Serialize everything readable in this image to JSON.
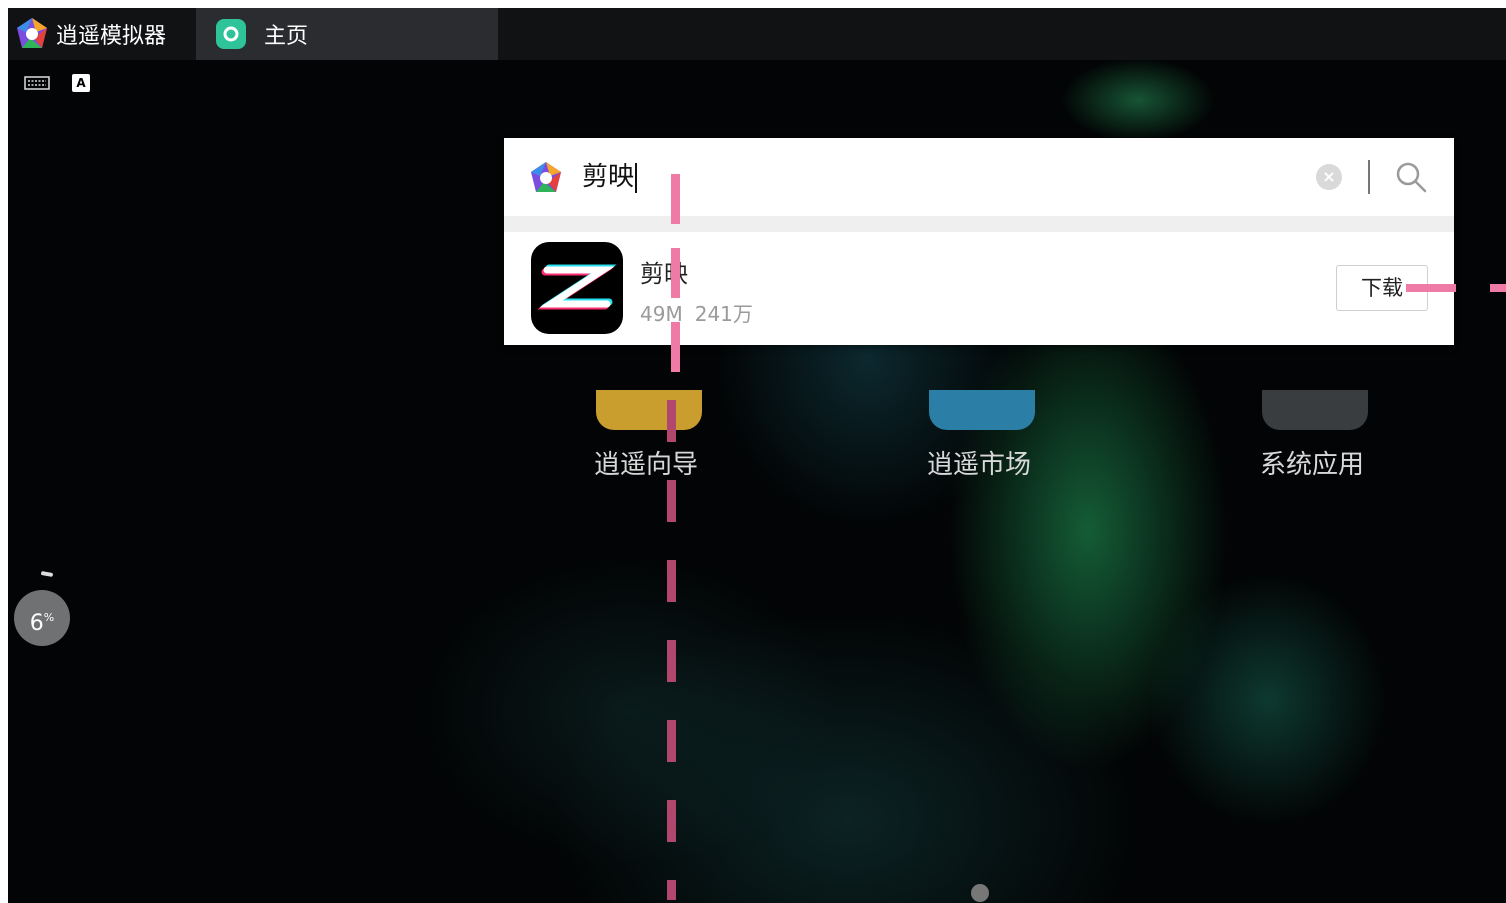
{
  "tabs": {
    "app_title": "逍遥模拟器",
    "home_tab": "主页"
  },
  "search": {
    "query": "剪映"
  },
  "result": {
    "name": "剪映",
    "size": "49M",
    "downloads": "241万",
    "download_label": "下载"
  },
  "desktop_icons": [
    {
      "label": "逍遥向导"
    },
    {
      "label": "逍遥市场"
    },
    {
      "label": "系统应用"
    }
  ],
  "progress": {
    "value": "6",
    "unit": "%"
  },
  "ime": {
    "label": "A"
  },
  "colors": {
    "annotation": "#f07aa6",
    "home_icon": "#2fc39a",
    "wallpaper_green": "#1e8c50"
  }
}
